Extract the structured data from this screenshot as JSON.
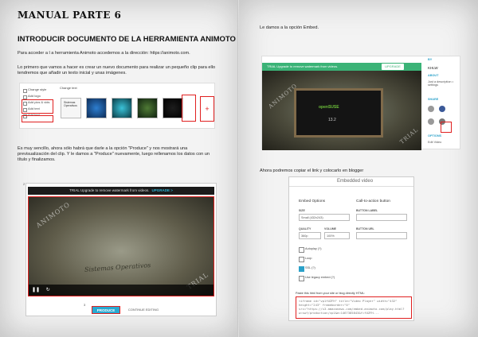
{
  "left": {
    "title": "MANUAL PARTE 6",
    "section": "INTRODUCIR DOCUMENTO DE LA HERRAMIENTA ANIMOTO",
    "p1": "Para acceder a l a herramienta Animoto accedemos a la dirección: https://animoto.com.",
    "p2": "Lo primero que vamos a hacer es crear un nuevo documento para realizar un pequeño clip para ello tendremos que añadir un texto inicial y unas imágenes.",
    "p3": "Es muy sencillo, ahora sólo habrá que darle a la opción \"Produce\" y nos mostrará una previsualización del clip. Y le damos a \"Produce\" nuevamente, luego rellenamos los datos con un título y finalizamos.",
    "shot1": {
      "menu": [
        "Change style",
        "Add logo",
        "Add pics & vids",
        "Add text",
        "Add text"
      ],
      "edit_label": "Change text",
      "thumb_text": "Sistemas Operativos",
      "add_symbol": "+"
    },
    "shot2": {
      "corner_num": "2",
      "trial": "TRIAL Upgrade to remove watermark from videos.",
      "upgrade": "UPGRADE >",
      "watermark1": "ANIMOTO",
      "watermark2": "TRIAL",
      "video_text": "Sistemas Operativos",
      "play_icon": "❚❚",
      "replay_icon": "↻",
      "produce": "PRODUCE",
      "continue": "CONTINUE EDITING",
      "bottom_num": "3"
    }
  },
  "right": {
    "text1": "Le damos a la opción Embed.",
    "text2": "Ahora podremos copiar el link y colocarlo en blogger",
    "shot3": {
      "trial": "TRIAL  Upgrade to remove watermark from videos.",
      "upgrade": "UPGRADE",
      "video_label": "openSUSE",
      "video_sub": "13.2",
      "watermark1": "ANIMOTO",
      "watermark2": "TRIAL",
      "side": {
        "by": "BY",
        "user": "KHLW",
        "about": "ABOUT",
        "about_text": "Just a description • settings",
        "share": "SHARE",
        "options": "OPTIONS",
        "edit_video": "Edit Video"
      }
    },
    "shot4": {
      "header": "Embedded video",
      "embed_options": "Embed Options",
      "cta_button": "Call-to-action button",
      "size_label": "SIZE",
      "size_value": "Small (432x243)",
      "quality_label": "QUALITY",
      "quality_value": "360p",
      "volume_label": "VOLUME",
      "volume_value": "100%",
      "button_label": "BUTTON LABEL",
      "button_url": "BUTTON URL",
      "checks": [
        "Autoplay (?)",
        "Loop",
        "SSL (?)",
        "Use legacy embed (?)"
      ],
      "code_label": "Paste this html from your site or blog directly HTML:",
      "code": "<iframe id=\"vp1fUZFH\" title=\"Video Player\" width=\"432\" height=\"243\" frameborder=\"0\" src=\"https://s3.amazonaws.com/embed.animoto.com/play.html?w=swf/production/vp1&e=1467385843&f=fUZFH..."
    }
  }
}
